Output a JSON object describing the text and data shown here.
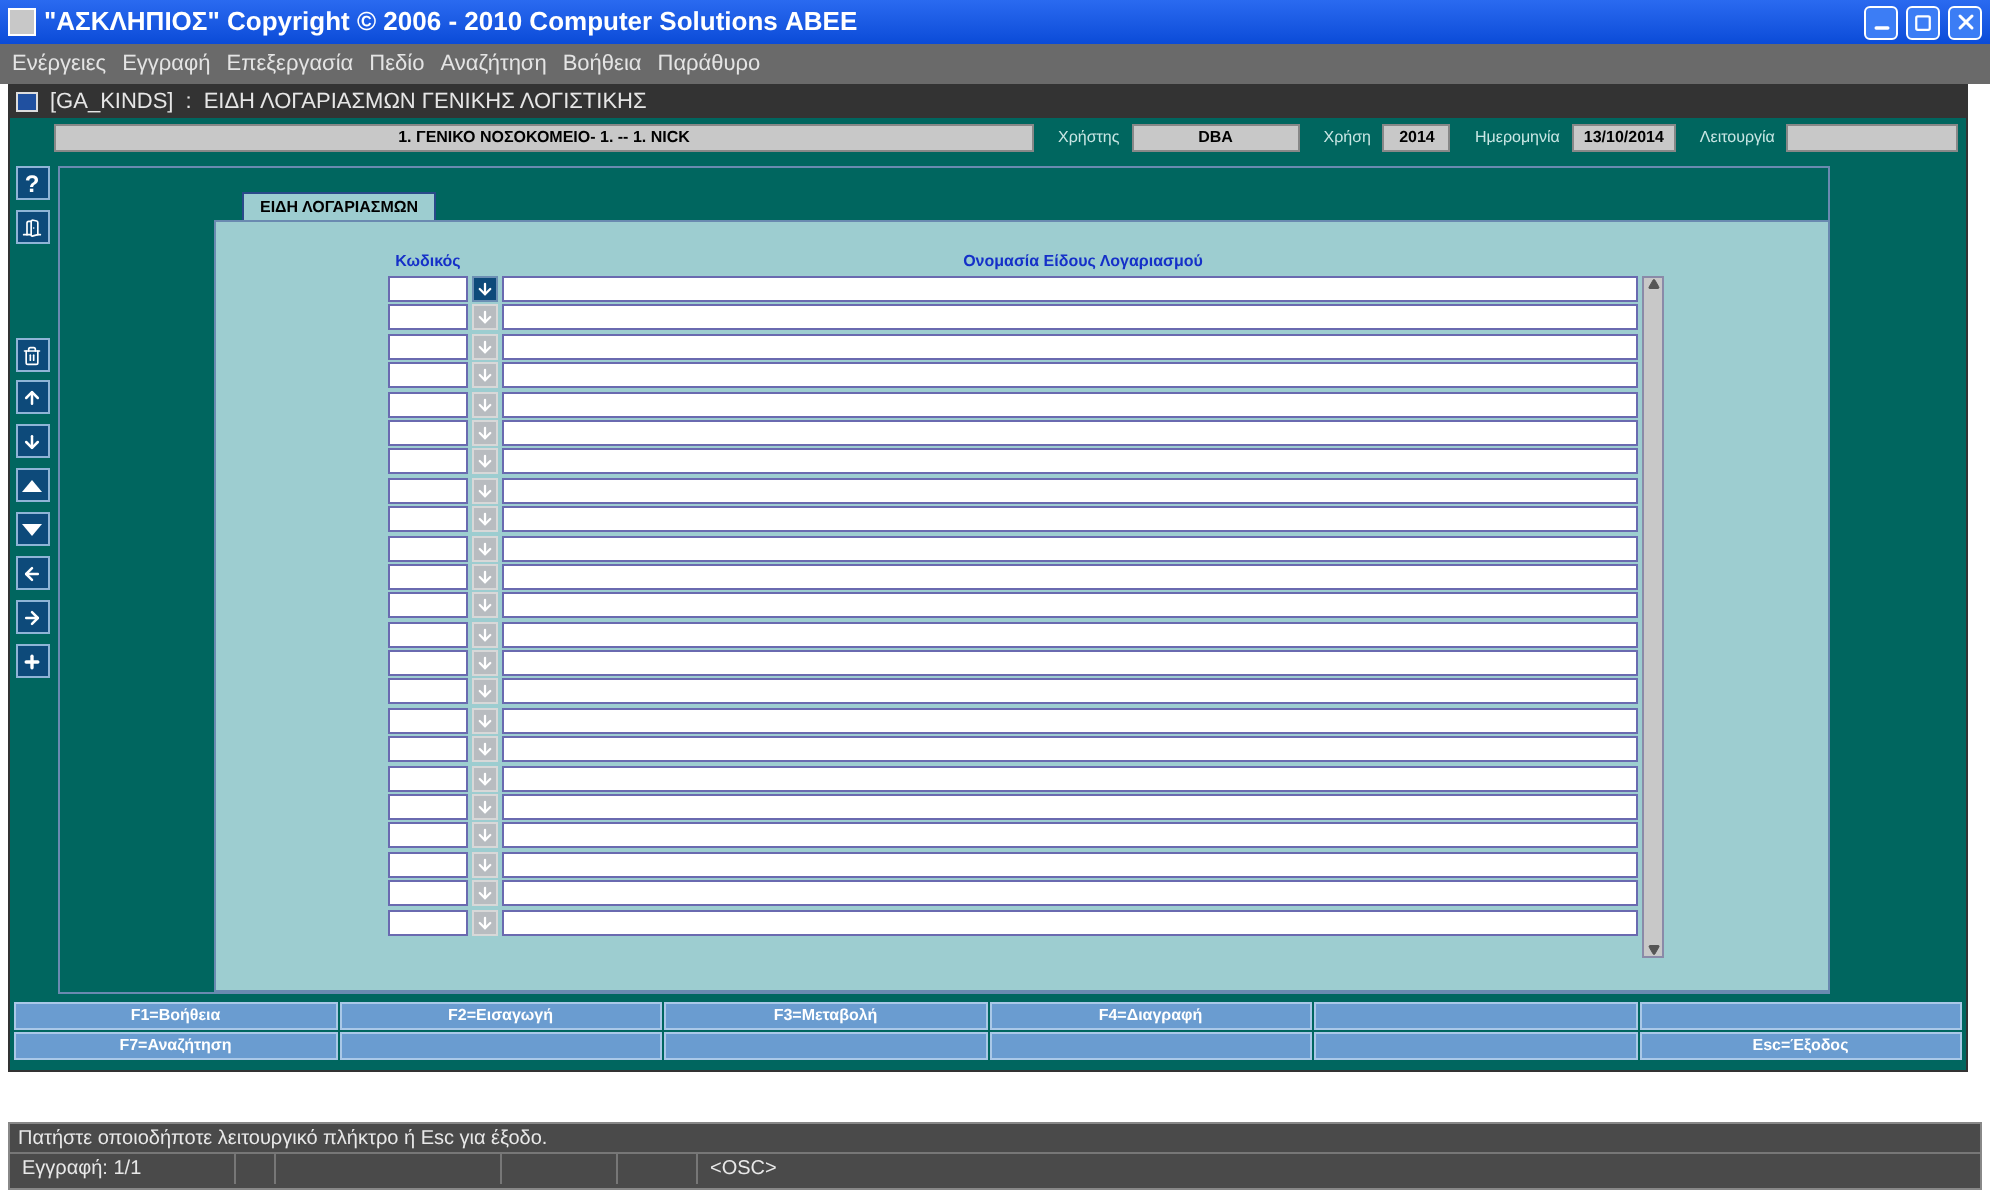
{
  "window": {
    "title": "\"ΑΣΚΛΗΠΙΟΣ\" Copyright © 2006 - 2010 Computer Solutions ΑΒΕΕ"
  },
  "menu": [
    "Ενέργειες",
    "Εγγραφή",
    "Επεξεργασία",
    "Πεδίο",
    "Αναζήτηση",
    "Βοήθεια",
    "Παράθυρο"
  ],
  "form": {
    "code": "[GA_KINDS]",
    "separator": ":",
    "title": "ΕΙΔΗ ΛΟΓΑΡΙΑΣΜΩΝ ΓΕΝΙΚΗΣ ΛΟΓΙΣΤΙΚΗΣ"
  },
  "info": {
    "company": "1. ΓΕΝΙΚΟ ΝΟΣΟΚΟΜΕΙΟ- 1. -- 1. NICK",
    "user_label": "Χρήστης",
    "user": "DBA",
    "year_label": "Χρήση",
    "year": "2014",
    "date_label": "Ημερομηνία",
    "date": "13/10/2014",
    "function_label": "Λειτουργία"
  },
  "toolbar": [
    {
      "kind": "help",
      "text": "?"
    },
    {
      "kind": "exit"
    },
    {
      "kind": "delete"
    },
    {
      "kind": "up"
    },
    {
      "kind": "down"
    },
    {
      "kind": "first"
    },
    {
      "kind": "last"
    },
    {
      "kind": "left"
    },
    {
      "kind": "right"
    },
    {
      "kind": "add"
    }
  ],
  "tab": {
    "label": "ΕΙΔΗ ΛΟΓΑΡΙΑΣΜΩΝ"
  },
  "table": {
    "columns": [
      "Κωδικός",
      "Ονομασία Είδους Λογαριασμού"
    ],
    "rows": [
      {
        "selected": true
      },
      {
        "selected": false
      },
      {
        "selected": false
      },
      {
        "selected": false
      },
      {
        "selected": false
      },
      {
        "selected": false
      },
      {
        "selected": false
      },
      {
        "selected": false
      },
      {
        "selected": false
      },
      {
        "selected": false
      },
      {
        "selected": false
      },
      {
        "selected": false
      },
      {
        "selected": false
      },
      {
        "selected": false
      },
      {
        "selected": false
      },
      {
        "selected": false
      },
      {
        "selected": false
      },
      {
        "selected": false
      },
      {
        "selected": false
      },
      {
        "selected": false
      },
      {
        "selected": false
      },
      {
        "selected": false
      },
      {
        "selected": false
      }
    ]
  },
  "function_keys": [
    [
      {
        "kind": "key",
        "label": "F1=Βοήθεια"
      },
      {
        "kind": "key",
        "label": "F2=Εισαγωγή"
      },
      {
        "kind": "key",
        "label": "F3=Μεταβολή"
      },
      {
        "kind": "key",
        "label": "F4=Διαγραφή"
      },
      {
        "kind": "blank"
      },
      {
        "kind": "blank"
      }
    ],
    [
      {
        "kind": "key",
        "label": "F7=Αναζήτηση"
      },
      {
        "kind": "blank"
      },
      {
        "kind": "blank"
      },
      {
        "kind": "blank"
      },
      {
        "kind": "blank"
      },
      {
        "kind": "key",
        "label": "Esc=Έξοδος"
      }
    ]
  ],
  "status": {
    "message": "Πατήστε οποιοδήποτε λειτουργικό πλήκτρο ή Esc για έξοδο.",
    "record": "Εγγραφή: 1/1",
    "mode": "<OSC>"
  }
}
